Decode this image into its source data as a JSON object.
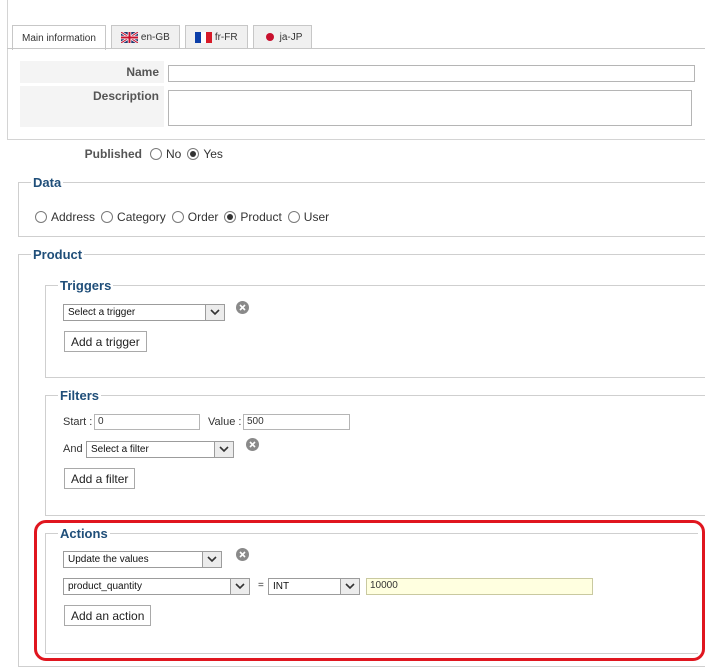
{
  "tabs": [
    {
      "label": "Main information",
      "flag": null
    },
    {
      "label": "en-GB",
      "flag": "gb-flag-icon"
    },
    {
      "label": "fr-FR",
      "flag": "fr-flag-icon"
    },
    {
      "label": "ja-JP",
      "flag": "jp-flag-icon"
    }
  ],
  "main": {
    "name_label": "Name",
    "name_value": "",
    "description_label": "Description",
    "description_value": "",
    "published_label": "Published",
    "published_options": [
      "No",
      "Yes"
    ],
    "published_selected": "Yes"
  },
  "data_section": {
    "legend": "Data",
    "options": [
      "Address",
      "Category",
      "Order",
      "Product",
      "User"
    ],
    "selected": "Product"
  },
  "product_section": {
    "legend": "Product",
    "triggers": {
      "legend": "Triggers",
      "select_value": "Select a trigger",
      "add_label": "Add a trigger"
    },
    "filters": {
      "legend": "Filters",
      "start_label": "Start :",
      "start_value": "0",
      "value_label": "Value :",
      "value_value": "500",
      "and_label": "And",
      "select_value": "Select a filter",
      "add_label": "Add a filter"
    },
    "actions": {
      "legend": "Actions",
      "action_select": "Update the values",
      "field_select": "product_quantity",
      "equals": "=",
      "type_select": "INT",
      "value": "10000",
      "add_label": "Add an action"
    }
  },
  "colors": {
    "legend_text": "#1f4e79",
    "highlight": "#e0161f",
    "active_input_bg": "#ffffe0"
  }
}
